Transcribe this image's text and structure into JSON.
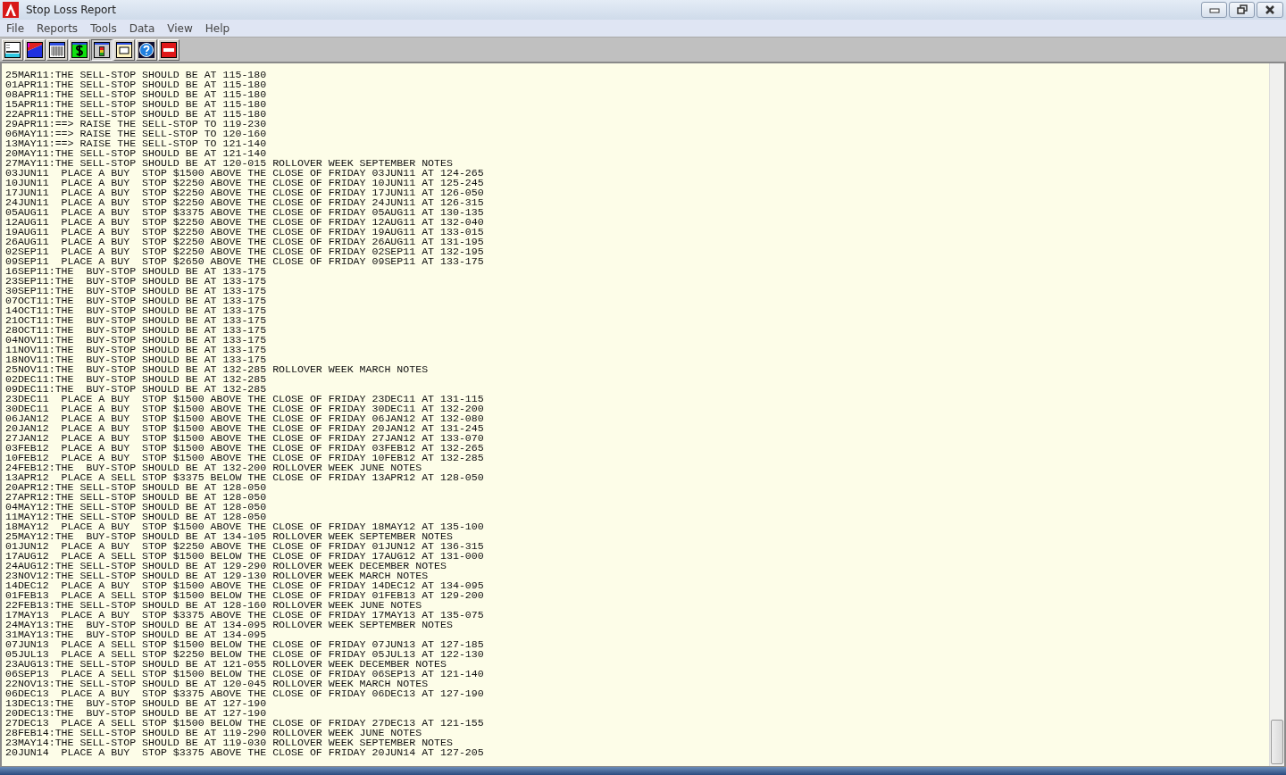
{
  "window": {
    "title": "Stop Loss Report"
  },
  "menu": [
    "File",
    "Reports",
    "Tools",
    "Data",
    "View",
    "Help"
  ],
  "toolbar": [
    {
      "kind": "screen",
      "pressed": false
    },
    {
      "kind": "chart",
      "pressed": false
    },
    {
      "kind": "grid",
      "pressed": false
    },
    {
      "kind": "dollar",
      "pressed": false
    },
    {
      "kind": "signal",
      "pressed": true
    },
    {
      "kind": "frame",
      "pressed": false
    },
    {
      "kind": "help",
      "pressed": false
    },
    {
      "kind": "stop",
      "pressed": false
    }
  ],
  "report": {
    "lines": [
      "25MAR11:THE SELL-STOP SHOULD BE AT 115-180",
      "01APR11:THE SELL-STOP SHOULD BE AT 115-180",
      "08APR11:THE SELL-STOP SHOULD BE AT 115-180",
      "15APR11:THE SELL-STOP SHOULD BE AT 115-180",
      "22APR11:THE SELL-STOP SHOULD BE AT 115-180",
      "29APR11:==> RAISE THE SELL-STOP TO 119-230",
      "06MAY11:==> RAISE THE SELL-STOP TO 120-160",
      "13MAY11:==> RAISE THE SELL-STOP TO 121-140",
      "20MAY11:THE SELL-STOP SHOULD BE AT 121-140",
      "27MAY11:THE SELL-STOP SHOULD BE AT 120-015 ROLLOVER WEEK SEPTEMBER NOTES",
      "03JUN11  PLACE A BUY  STOP $1500 ABOVE THE CLOSE OF FRIDAY 03JUN11 AT 124-265",
      "10JUN11  PLACE A BUY  STOP $2250 ABOVE THE CLOSE OF FRIDAY 10JUN11 AT 125-245",
      "17JUN11  PLACE A BUY  STOP $2250 ABOVE THE CLOSE OF FRIDAY 17JUN11 AT 126-050",
      "24JUN11  PLACE A BUY  STOP $2250 ABOVE THE CLOSE OF FRIDAY 24JUN11 AT 126-315",
      "05AUG11  PLACE A BUY  STOP $3375 ABOVE THE CLOSE OF FRIDAY 05AUG11 AT 130-135",
      "12AUG11  PLACE A BUY  STOP $2250 ABOVE THE CLOSE OF FRIDAY 12AUG11 AT 132-040",
      "19AUG11  PLACE A BUY  STOP $2250 ABOVE THE CLOSE OF FRIDAY 19AUG11 AT 133-015",
      "26AUG11  PLACE A BUY  STOP $2250 ABOVE THE CLOSE OF FRIDAY 26AUG11 AT 131-195",
      "02SEP11  PLACE A BUY  STOP $2250 ABOVE THE CLOSE OF FRIDAY 02SEP11 AT 132-195",
      "09SEP11  PLACE A BUY  STOP $2650 ABOVE THE CLOSE OF FRIDAY 09SEP11 AT 133-175",
      "16SEP11:THE  BUY-STOP SHOULD BE AT 133-175",
      "23SEP11:THE  BUY-STOP SHOULD BE AT 133-175",
      "30SEP11:THE  BUY-STOP SHOULD BE AT 133-175",
      "07OCT11:THE  BUY-STOP SHOULD BE AT 133-175",
      "14OCT11:THE  BUY-STOP SHOULD BE AT 133-175",
      "21OCT11:THE  BUY-STOP SHOULD BE AT 133-175",
      "28OCT11:THE  BUY-STOP SHOULD BE AT 133-175",
      "04NOV11:THE  BUY-STOP SHOULD BE AT 133-175",
      "11NOV11:THE  BUY-STOP SHOULD BE AT 133-175",
      "18NOV11:THE  BUY-STOP SHOULD BE AT 133-175",
      "25NOV11:THE  BUY-STOP SHOULD BE AT 132-285 ROLLOVER WEEK MARCH NOTES",
      "02DEC11:THE  BUY-STOP SHOULD BE AT 132-285",
      "09DEC11:THE  BUY-STOP SHOULD BE AT 132-285",
      "23DEC11  PLACE A BUY  STOP $1500 ABOVE THE CLOSE OF FRIDAY 23DEC11 AT 131-115",
      "30DEC11  PLACE A BUY  STOP $1500 ABOVE THE CLOSE OF FRIDAY 30DEC11 AT 132-200",
      "06JAN12  PLACE A BUY  STOP $1500 ABOVE THE CLOSE OF FRIDAY 06JAN12 AT 132-080",
      "20JAN12  PLACE A BUY  STOP $1500 ABOVE THE CLOSE OF FRIDAY 20JAN12 AT 131-245",
      "27JAN12  PLACE A BUY  STOP $1500 ABOVE THE CLOSE OF FRIDAY 27JAN12 AT 133-070",
      "03FEB12  PLACE A BUY  STOP $1500 ABOVE THE CLOSE OF FRIDAY 03FEB12 AT 132-265",
      "10FEB12  PLACE A BUY  STOP $1500 ABOVE THE CLOSE OF FRIDAY 10FEB12 AT 132-285",
      "24FEB12:THE  BUY-STOP SHOULD BE AT 132-200 ROLLOVER WEEK JUNE NOTES",
      "13APR12  PLACE A SELL STOP $3375 BELOW THE CLOSE OF FRIDAY 13APR12 AT 128-050",
      "20APR12:THE SELL-STOP SHOULD BE AT 128-050",
      "27APR12:THE SELL-STOP SHOULD BE AT 128-050",
      "04MAY12:THE SELL-STOP SHOULD BE AT 128-050",
      "11MAY12:THE SELL-STOP SHOULD BE AT 128-050",
      "18MAY12  PLACE A BUY  STOP $1500 ABOVE THE CLOSE OF FRIDAY 18MAY12 AT 135-100",
      "25MAY12:THE  BUY-STOP SHOULD BE AT 134-105 ROLLOVER WEEK SEPTEMBER NOTES",
      "01JUN12  PLACE A BUY  STOP $2250 ABOVE THE CLOSE OF FRIDAY 01JUN12 AT 136-315",
      "17AUG12  PLACE A SELL STOP $1500 BELOW THE CLOSE OF FRIDAY 17AUG12 AT 131-000",
      "24AUG12:THE SELL-STOP SHOULD BE AT 129-290 ROLLOVER WEEK DECEMBER NOTES",
      "23NOV12:THE SELL-STOP SHOULD BE AT 129-130 ROLLOVER WEEK MARCH NOTES",
      "14DEC12  PLACE A BUY  STOP $1500 ABOVE THE CLOSE OF FRIDAY 14DEC12 AT 134-095",
      "01FEB13  PLACE A SELL STOP $1500 BELOW THE CLOSE OF FRIDAY 01FEB13 AT 129-200",
      "22FEB13:THE SELL-STOP SHOULD BE AT 128-160 ROLLOVER WEEK JUNE NOTES",
      "17MAY13  PLACE A BUY  STOP $3375 ABOVE THE CLOSE OF FRIDAY 17MAY13 AT 135-075",
      "24MAY13:THE  BUY-STOP SHOULD BE AT 134-095 ROLLOVER WEEK SEPTEMBER NOTES",
      "31MAY13:THE  BUY-STOP SHOULD BE AT 134-095",
      "07JUN13  PLACE A SELL STOP $1500 BELOW THE CLOSE OF FRIDAY 07JUN13 AT 127-185",
      "05JUL13  PLACE A SELL STOP $2250 BELOW THE CLOSE OF FRIDAY 05JUL13 AT 122-130",
      "23AUG13:THE SELL-STOP SHOULD BE AT 121-055 ROLLOVER WEEK DECEMBER NOTES",
      "06SEP13  PLACE A SELL STOP $1500 BELOW THE CLOSE OF FRIDAY 06SEP13 AT 121-140",
      "22NOV13:THE SELL-STOP SHOULD BE AT 120-045 ROLLOVER WEEK MARCH NOTES",
      "06DEC13  PLACE A BUY  STOP $3375 ABOVE THE CLOSE OF FRIDAY 06DEC13 AT 127-190",
      "13DEC13:THE  BUY-STOP SHOULD BE AT 127-190",
      "20DEC13:THE  BUY-STOP SHOULD BE AT 127-190",
      "27DEC13  PLACE A SELL STOP $1500 BELOW THE CLOSE OF FRIDAY 27DEC13 AT 121-155",
      "28FEB14:THE SELL-STOP SHOULD BE AT 119-290 ROLLOVER WEEK JUNE NOTES",
      "23MAY14:THE SELL-STOP SHOULD BE AT 119-030 ROLLOVER WEEK SEPTEMBER NOTES",
      "20JUN14  PLACE A BUY  STOP $3375 ABOVE THE CLOSE OF FRIDAY 20JUN14 AT 127-205"
    ]
  }
}
